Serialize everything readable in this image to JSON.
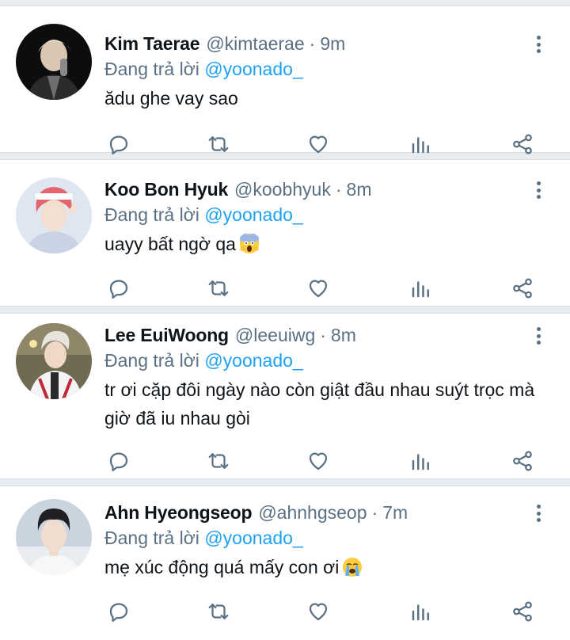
{
  "colors": {
    "link": "#1da1f2",
    "secondary": "#5b7083",
    "text": "#0f1419",
    "divider": "#e6ecf0"
  },
  "tweets": [
    {
      "name": "Kim Taerae",
      "handle": "@kimtaerae",
      "separator": "·",
      "time": "9m",
      "reply_prefix": "Đang trả lời",
      "reply_to": "@yoonado_",
      "text": "ădu ghe vay sao",
      "emoji": ""
    },
    {
      "name": "Koo Bon Hyuk",
      "handle": "@koobhyuk",
      "separator": "·",
      "time": "8m",
      "reply_prefix": "Đang trả lời",
      "reply_to": "@yoonado_",
      "text": "uayy bất ngờ qa",
      "emoji": "face-screaming-in-fear-emoji"
    },
    {
      "name": "Lee EuiWoong",
      "handle": "@leeuiwg",
      "separator": "·",
      "time": "8m",
      "reply_prefix": "Đang trả lời",
      "reply_to": "@yoonado_",
      "text": "tr ơi cặp đôi ngày nào còn giật đầu nhau suýt trọc mà giờ đã iu nhau gòi",
      "emoji": ""
    },
    {
      "name": "Ahn Hyeongseop",
      "handle": "@ahnhgseop",
      "separator": "·",
      "time": "7m",
      "reply_prefix": "Đang trả lời",
      "reply_to": "@yoonado_",
      "text": "mẹ xúc động quá mấy con ơi",
      "emoji": "loudly-crying-face-emoji"
    }
  ],
  "action_icons": [
    "reply-icon",
    "retweet-icon",
    "like-icon",
    "views-icon",
    "share-icon"
  ]
}
